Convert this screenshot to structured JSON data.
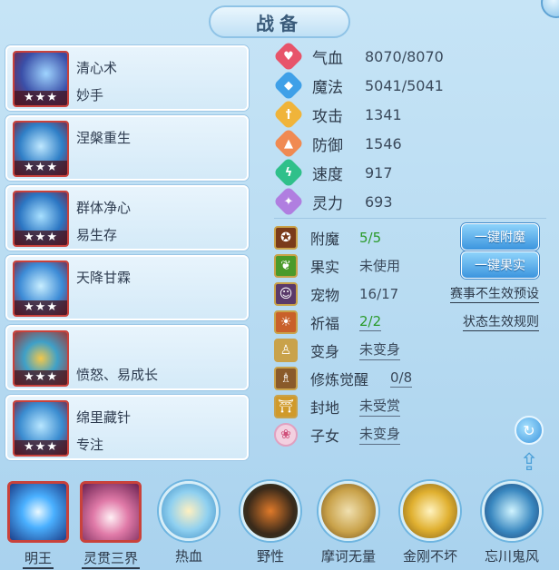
{
  "title": "战备",
  "skills": [
    {
      "name": "清心术",
      "desc": "妙手",
      "stars": "★★★",
      "icon": "blade-icon",
      "color": "#3a4fa8"
    },
    {
      "name": "涅槃重生",
      "desc": "",
      "stars": "★★★",
      "icon": "phoenix-crown-icon",
      "color": "#2f7fc7"
    },
    {
      "name": "群体净心",
      "desc": "易生存",
      "stars": "★★★",
      "icon": "crown-icon",
      "color": "#2b76c3"
    },
    {
      "name": "天降甘霖",
      "desc": "",
      "stars": "★★★",
      "icon": "rain-icon",
      "color": "#3c8bd6"
    },
    {
      "name": "",
      "desc": "愤怒、易成长",
      "stars": "★★★",
      "icon": "treasure-bowl-icon",
      "color": "#9a3a3a"
    },
    {
      "name": "绵里藏针",
      "desc": "专注",
      "stars": "★★★",
      "icon": "needle-icon",
      "color": "#3a8cd0"
    }
  ],
  "stats": [
    {
      "label": "气血",
      "value": "8070/8070",
      "icon": "heart-icon",
      "color": "#e7546a"
    },
    {
      "label": "魔法",
      "value": "5041/5041",
      "icon": "mana-icon",
      "color": "#3fa0e8"
    },
    {
      "label": "攻击",
      "value": "1341",
      "icon": "sword-icon",
      "color": "#f0b43a"
    },
    {
      "label": "防御",
      "value": "1546",
      "icon": "shield-icon",
      "color": "#f08a52"
    },
    {
      "label": "速度",
      "value": "917",
      "icon": "speed-icon",
      "color": "#2fc08a"
    },
    {
      "label": "灵力",
      "value": "693",
      "icon": "spirit-icon",
      "color": "#b07ee0"
    }
  ],
  "attrs": {
    "enchant": {
      "label": "附魔",
      "value": "5/5",
      "button": "一键附魔"
    },
    "fruit": {
      "label": "果实",
      "value": "未使用",
      "button": "一键果实"
    },
    "pet": {
      "label": "宠物",
      "value": "16/17",
      "link": "赛事不生效预设"
    },
    "blessing": {
      "label": "祈福",
      "value": "2/2",
      "link": "状态生效规则"
    },
    "transform": {
      "label": "变身",
      "value": "未变身"
    },
    "awaken": {
      "label": "修炼觉醒",
      "value": "0/8"
    },
    "territory": {
      "label": "封地",
      "value": "未受赏"
    },
    "children": {
      "label": "子女",
      "value": "未变身"
    }
  },
  "bottom_skills": [
    {
      "label": "明王",
      "shape": "square",
      "color": "#1d4fa8"
    },
    {
      "label": "灵贯三界",
      "shape": "square",
      "color": "#b0507a"
    },
    {
      "label": "热血",
      "shape": "round",
      "color": "#5fb0e0"
    },
    {
      "label": "野性",
      "shape": "round",
      "color": "#3a5a2a"
    },
    {
      "label": "摩诃无量",
      "shape": "round",
      "color": "#c9a24a"
    },
    {
      "label": "金刚不坏",
      "shape": "round",
      "color": "#b08a2a"
    },
    {
      "label": "忘川鬼风",
      "shape": "round",
      "color": "#3a88c0"
    }
  ]
}
